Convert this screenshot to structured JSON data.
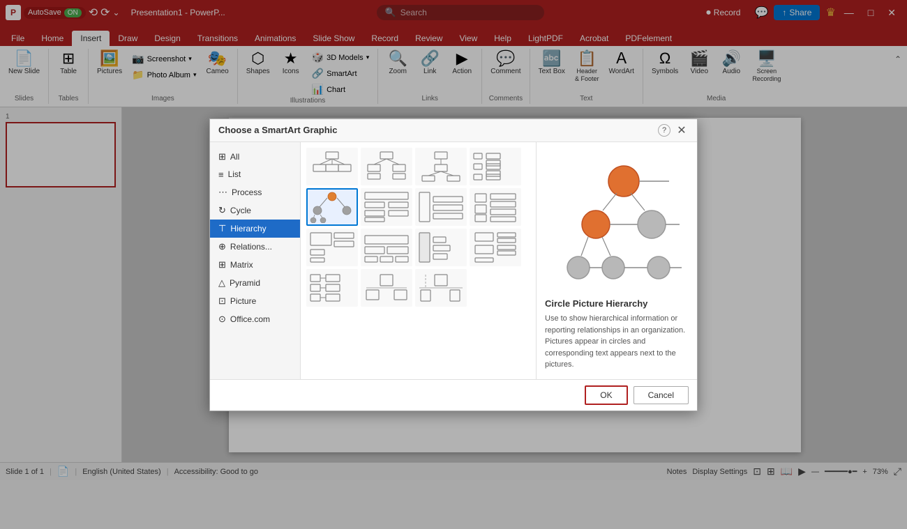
{
  "appBar": {
    "logoText": "P",
    "autosave": "AutoSave",
    "autosaveState": "ON",
    "undoLabel": "⟲",
    "redoLabel": "⟳",
    "fileName": "Presentation1 - PowerP...",
    "searchPlaceholder": "Search",
    "recordBtn": "Record",
    "shareBtn": "Share",
    "helpBtn": "?",
    "minimize": "—",
    "maximize": "□",
    "close": "✕"
  },
  "ribbonTabs": [
    "File",
    "Home",
    "Insert",
    "Draw",
    "Design",
    "Transitions",
    "Animations",
    "Slide Show",
    "Record",
    "Review",
    "View",
    "Help",
    "LightPDF",
    "Acrobat",
    "PDFelement"
  ],
  "activeTab": "Insert",
  "ribbonGroups": {
    "slides": {
      "label": "Slides",
      "newSlide": "New Slide"
    },
    "tables": {
      "label": "Tables",
      "table": "Table"
    },
    "images": {
      "label": "Images",
      "pictures": "Pictures",
      "screenshot": "Screenshot",
      "photoAlbum": "Photo Album",
      "cameo": "Cameo"
    },
    "illustrations": {
      "label": "Illustrations",
      "shapes": "Shapes",
      "icons": "Icons",
      "3dModels": "3D Models",
      "smartArt": "SmartArt",
      "chart": "Chart"
    },
    "links": {
      "label": "Links",
      "zoom": "Zoom",
      "link": "Link",
      "action": "Action"
    },
    "comments": {
      "label": "Comments",
      "comment": "Comment"
    },
    "text": {
      "label": "Text",
      "textBox": "Text Box",
      "headerFooter": "Header & Footer",
      "wordArt": "WordArt"
    },
    "media": {
      "label": "Media",
      "symbols": "Symbols",
      "video": "Video",
      "audio": "Audio",
      "screenRecording": "Screen Recording"
    }
  },
  "slidePanel": {
    "slideNumber": "1"
  },
  "statusBar": {
    "slideInfo": "Slide 1 of 1",
    "language": "English (United States)",
    "accessibility": "Accessibility: Good to go",
    "notes": "Notes",
    "displaySettings": "Display Settings",
    "zoomLevel": "73%"
  },
  "dialog": {
    "title": "Choose a SmartArt Graphic",
    "helpBtn": "?",
    "closeBtn": "✕",
    "categories": [
      {
        "id": "all",
        "icon": "⊞",
        "label": "All"
      },
      {
        "id": "list",
        "icon": "≡",
        "label": "List"
      },
      {
        "id": "process",
        "icon": "⋯",
        "label": "Process"
      },
      {
        "id": "cycle",
        "icon": "↻",
        "label": "Cycle"
      },
      {
        "id": "hierarchy",
        "icon": "⊤",
        "label": "Hierarchy"
      },
      {
        "id": "relationship",
        "icon": "⊕",
        "label": "Relations..."
      },
      {
        "id": "matrix",
        "icon": "⊞",
        "label": "Matrix"
      },
      {
        "id": "pyramid",
        "icon": "△",
        "label": "Pyramid"
      },
      {
        "id": "picture",
        "icon": "⊡",
        "label": "Picture"
      },
      {
        "id": "officecom",
        "icon": "⊙",
        "label": "Office.com"
      }
    ],
    "activeCategory": "hierarchy",
    "selectedGraphic": 1,
    "previewTitle": "Circle Picture Hierarchy",
    "previewDesc": "Use to show hierarchical information or reporting relationships in an organization. Pictures appear in circles and corresponding text appears next to the pictures.",
    "okLabel": "OK",
    "cancelLabel": "Cancel"
  }
}
